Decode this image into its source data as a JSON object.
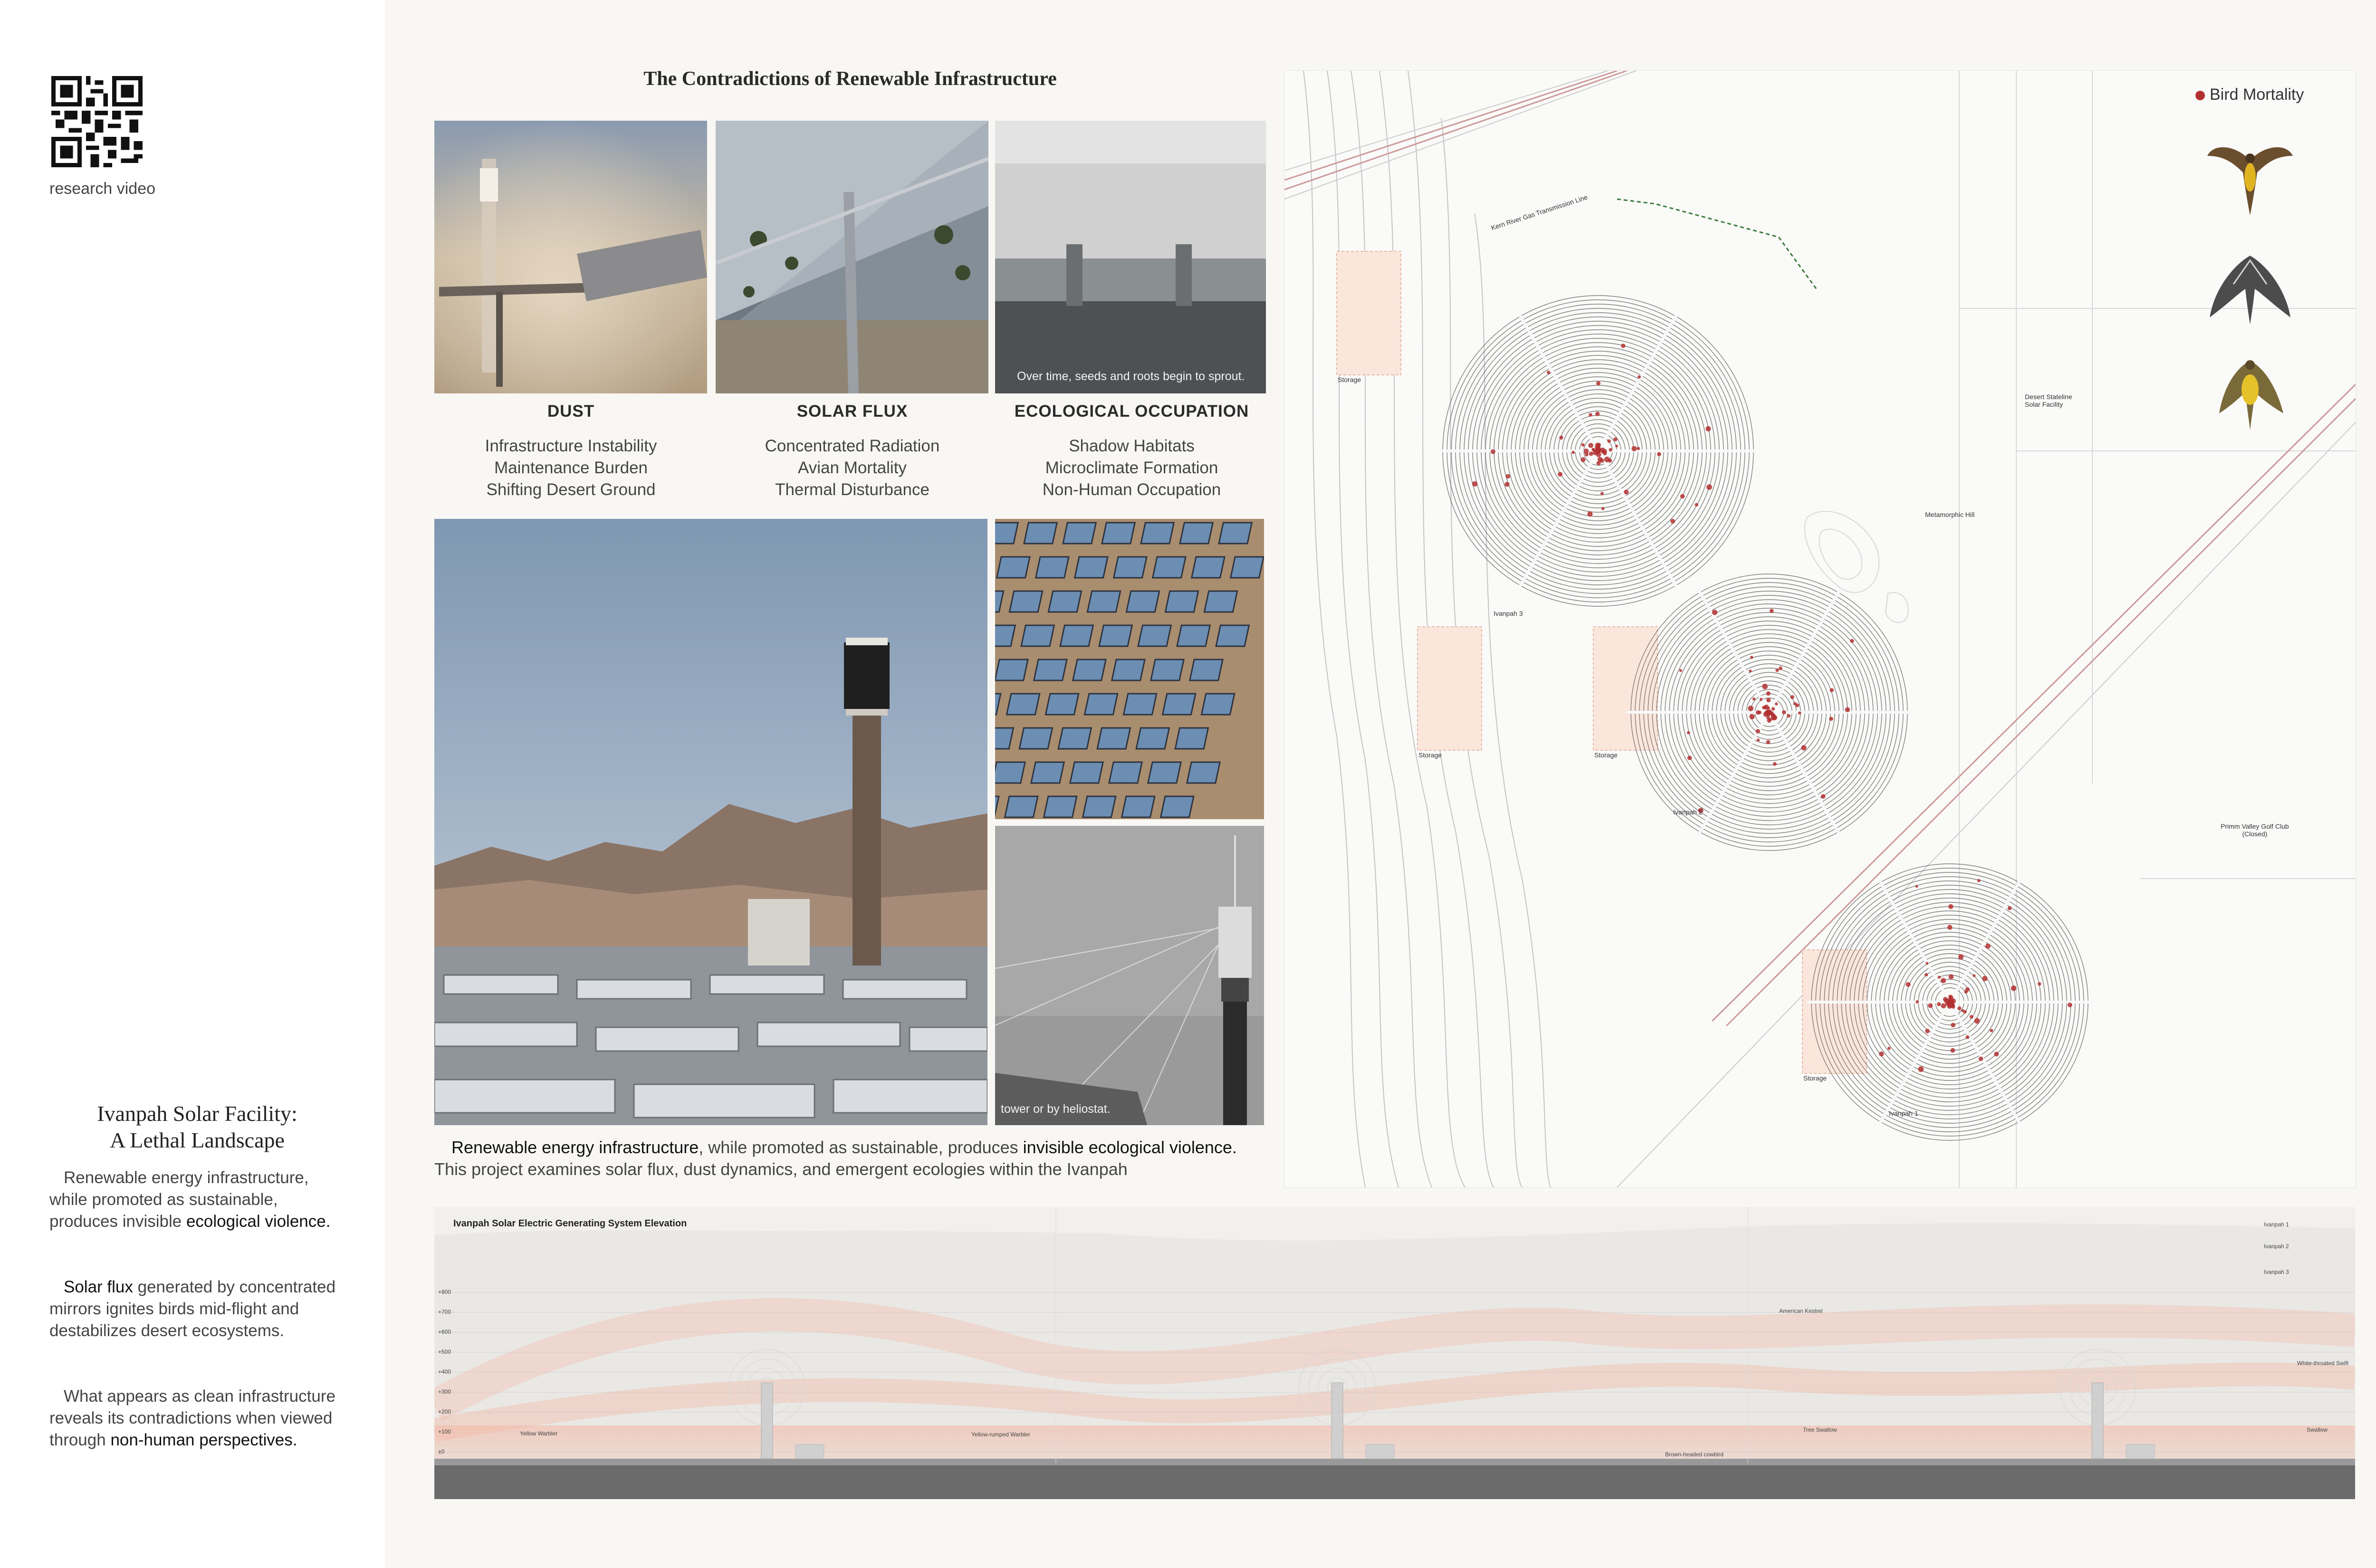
{
  "sidebar": {
    "qr_caption": "research video",
    "title_line1": "Ivanpah Solar Facility:",
    "title_line2": "A Lethal Landscape",
    "para1_a": "Renewable energy infrastructure, while promoted as sustainable, produces invisible ",
    "para1_b": "ecological violence.",
    "para2_a": "Solar flux",
    "para2_b": " generated by concentrated mirrors ignites birds mid-flight and destabilizes desert ecosystems.",
    "para3_a": "What appears as clean infrastructure reveals its contradictions when viewed through ",
    "para3_b": "non-human perspectives."
  },
  "main": {
    "title": "The Contradictions of Renewable Infrastructure",
    "panels": [
      {
        "title": "DUST",
        "items": [
          "Infrastructure Instability",
          "Maintenance Burden",
          "Shifting Desert Ground"
        ]
      },
      {
        "title": "SOLAR FLUX",
        "items": [
          "Concentrated Radiation",
          "Avian Mortality",
          "Thermal Disturbance"
        ]
      },
      {
        "title": "ECOLOGICAL OCCUPATION",
        "items": [
          "Shadow Habitats",
          "Microclimate Formation",
          "Non-Human Occupation"
        ]
      }
    ],
    "photo_overlay_1": "Over time, seeds and roots begin to sprout.",
    "photo_overlay_2": "tower or by heliostat.",
    "body_a": "Renewable energy infrastructure",
    "body_b": ", while promoted as sustainable, produces ",
    "body_c": "invisible ecological violence.",
    "body_d": " This project examines solar flux, dust dynamics, and emergent ecologies within the Ivanpah"
  },
  "map": {
    "legend": "Bird Mortality",
    "labels": {
      "pipeline": "Kern River Gas Transmission Line",
      "storage": "Storage",
      "ivanpah1": "Ivanpah 1",
      "ivanpah2": "Ivanpah 2",
      "ivanpah3": "Ivanpah 3",
      "stateline_1": "Desert Stateline",
      "stateline_2": "Solar Facility",
      "hill": "Metamorphic Hill",
      "golf_1": "Primm Valley Golf Club",
      "golf_2": "(Closed)"
    },
    "colors": {
      "mortality": "#b23030",
      "field": "#555555",
      "pipeline": "#3b7a3b"
    }
  },
  "elevation": {
    "title": "Ivanpah Solar Electric Generating System Elevation",
    "birds": [
      "Yellow Warbler",
      "Yellow-rumped Warbler",
      "American Kestrel",
      "Brown-headed cowbird",
      "Tree Swallow",
      "White-throated Swift",
      "Swallow"
    ],
    "legend": [
      "Ivanpah 1",
      "Ivanpah 2",
      "Ivanpah 3"
    ],
    "heights": [
      "+800",
      "+700",
      "+600",
      "+500",
      "+400",
      "+300",
      "+200",
      "+100",
      "±0"
    ]
  }
}
